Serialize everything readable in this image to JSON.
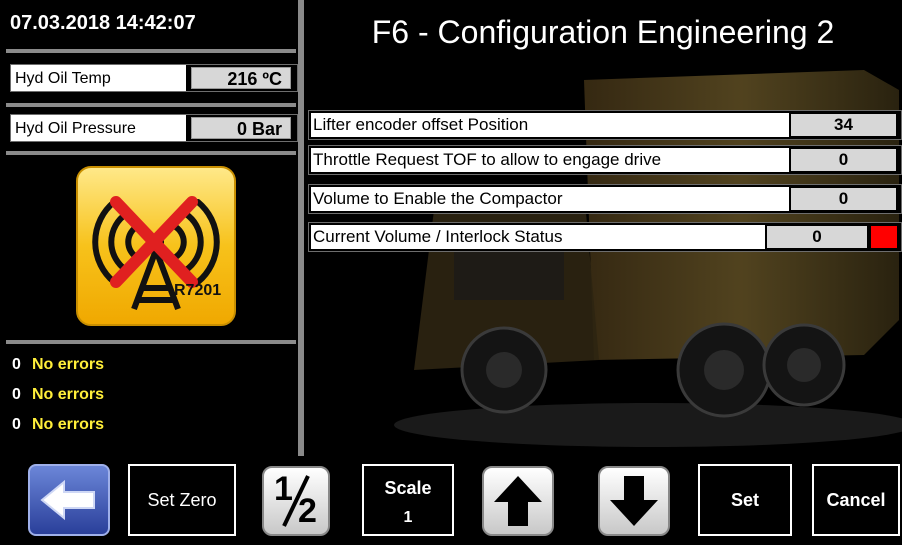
{
  "status": {
    "datetime": "07.03.2018 14:42:07"
  },
  "readouts": [
    {
      "label": "Hyd Oil Temp",
      "value": "216 ºC"
    },
    {
      "label": "Hyd Oil Pressure",
      "value": "0 Bar"
    }
  ],
  "radio_status": {
    "icon": "radio-tower-disabled-icon",
    "badge": "R7201"
  },
  "errors": [
    {
      "count": "0",
      "text": "No errors"
    },
    {
      "count": "0",
      "text": "No errors"
    },
    {
      "count": "0",
      "text": "No errors"
    }
  ],
  "page": {
    "title": "F6 - Configuration Engineering 2"
  },
  "params": [
    {
      "label": "Lifter encoder offset Position",
      "value": "34"
    },
    {
      "label": "Throttle Request TOF to allow to engage drive",
      "value": "0"
    },
    {
      "label": "Volume to Enable the Compactor",
      "value": "0"
    },
    {
      "label": "Current Volume / Interlock Status",
      "value": "0",
      "status_color": "#ff0000"
    }
  ],
  "toolbar": {
    "back_icon": "arrow-left-icon",
    "set_zero": "Set Zero",
    "half_num": "1",
    "half_den": "2",
    "scale_label": "Scale",
    "scale_value": "1",
    "up_icon": "arrow-up-icon",
    "down_icon": "arrow-down-icon",
    "set": "Set",
    "cancel": "Cancel"
  },
  "colors": {
    "warning_text": "#ffef3a",
    "icon_yellow": "#f7c21b",
    "interlock_red": "#ff0000",
    "value_bg": "#d7d7d7"
  }
}
